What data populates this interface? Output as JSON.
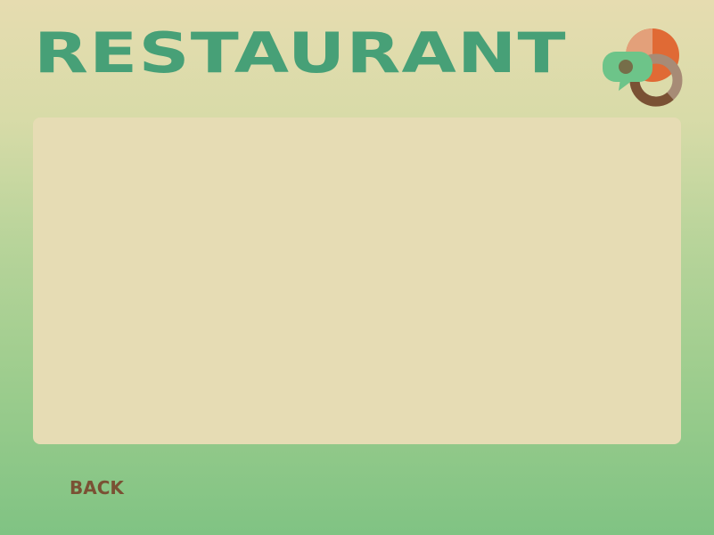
{
  "screen": {
    "title": "RESTAURANT",
    "back_label": "BACK"
  },
  "logo": {
    "icon": "restaurant-chat-pie-logo",
    "colors": {
      "pie_main": "#e06a35",
      "pie_slice": "#e3a07a",
      "ring_light": "#a78b76",
      "ring_dark": "#7a5134",
      "bubble": "#6dc489"
    }
  },
  "colors": {
    "title": "#47a077",
    "back": "#7a5134",
    "panel": "#e6dcb4"
  }
}
